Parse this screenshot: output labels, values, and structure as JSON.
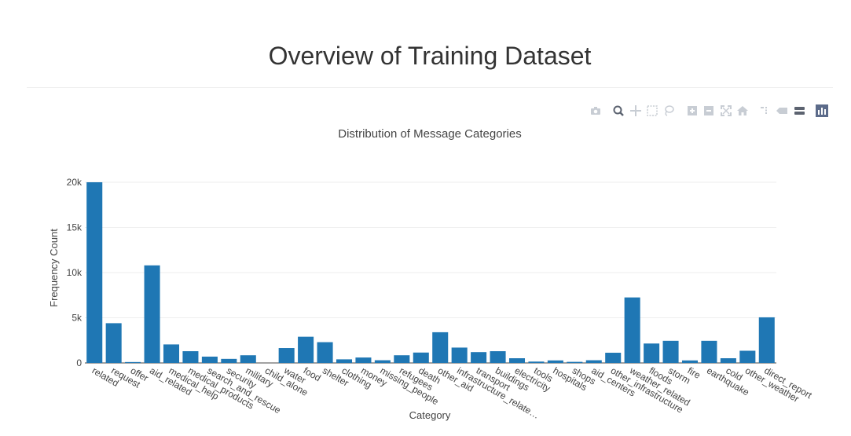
{
  "page": {
    "title": "Overview of Training Dataset"
  },
  "modebar": {
    "buttons": [
      "camera-icon",
      "zoom-icon",
      "pan-icon",
      "box-select-icon",
      "lasso-icon",
      "zoom-in-icon",
      "zoom-out-icon",
      "autoscale-icon",
      "reset-axes-icon",
      "spike-lines-icon",
      "hover-closest-icon",
      "hover-compare-icon",
      "plotly-logo-icon"
    ]
  },
  "colors": {
    "bar": "#1f77b4",
    "grid": "#eeeeee",
    "text": "#444444",
    "title": "#333333"
  },
  "chart_data": {
    "type": "bar",
    "title": "Distribution of Message Categories",
    "xlabel": "Category",
    "ylabel": "Frequency Count",
    "ylim": [
      0,
      20000
    ],
    "yticks": [
      0,
      5000,
      10000,
      15000,
      20000
    ],
    "ytick_labels": [
      "0",
      "5k",
      "10k",
      "15k",
      "20k"
    ],
    "grid": true,
    "categories": [
      "related",
      "request",
      "offer",
      "aid_related",
      "medical_help",
      "medical_products",
      "search_and_rescue",
      "security",
      "military",
      "child_alone",
      "water",
      "food",
      "shelter",
      "clothing",
      "money",
      "missing_people",
      "refugees",
      "death",
      "other_aid",
      "infrastructure_related",
      "transport",
      "buildings",
      "electricity",
      "tools",
      "hospitals",
      "shops",
      "aid_centers",
      "other_infrastructure",
      "weather_related",
      "floods",
      "storm",
      "fire",
      "earthquake",
      "cold",
      "other_weather",
      "direct_report"
    ],
    "tick_labels": [
      "related",
      "request",
      "offer",
      "aid_related",
      "medical_help",
      "medical_products",
      "search_and_rescue",
      "security",
      "military",
      "child_alone",
      "water",
      "food",
      "shelter",
      "clothing",
      "money",
      "missing_people",
      "refugees",
      "death",
      "other_aid",
      "infrastructure_relate…",
      "transport",
      "buildings",
      "electricity",
      "tools",
      "hospitals",
      "shops",
      "aid_centers",
      "other_infrastructure",
      "weather_related",
      "floods",
      "storm",
      "fire",
      "earthquake",
      "cold",
      "other_weather",
      "direct_report"
    ],
    "values": [
      20000,
      4400,
      100,
      10800,
      2050,
      1300,
      700,
      450,
      850,
      0,
      1650,
      2900,
      2300,
      400,
      600,
      300,
      850,
      1150,
      3400,
      1700,
      1200,
      1300,
      520,
      150,
      280,
      120,
      300,
      1130,
      7250,
      2150,
      2450,
      280,
      2450,
      520,
      1350,
      5050
    ]
  }
}
